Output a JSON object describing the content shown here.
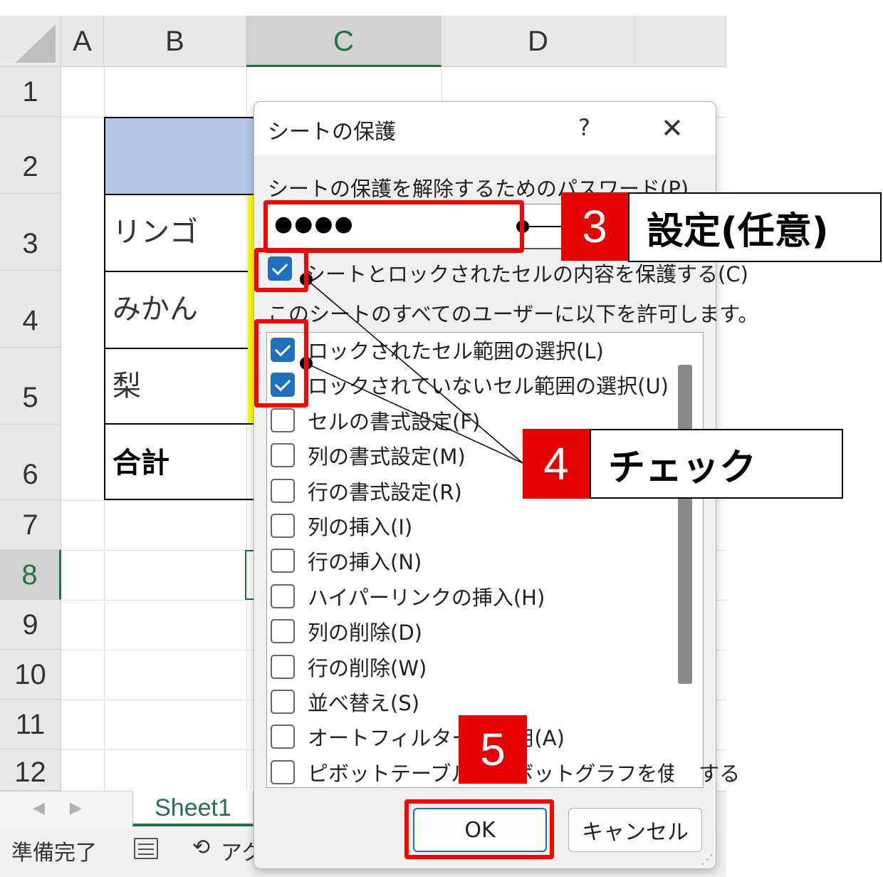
{
  "spreadsheet": {
    "columns": [
      "A",
      "B",
      "C",
      "D"
    ],
    "rows": [
      "1",
      "2",
      "3",
      "4",
      "5",
      "6",
      "7",
      "8",
      "9",
      "10",
      "11",
      "12"
    ],
    "selected_column": "C",
    "selected_row": "8",
    "cells": {
      "b3": "リンゴ",
      "b4": "みかん",
      "b5": "梨",
      "b6": "合計"
    },
    "sheet_tab": "Sheet1",
    "status": {
      "ready": "準備完了",
      "accessibility": "アク"
    },
    "colors": {
      "header_fill": "#b4c6e7",
      "accent": "#217346",
      "highlight": "#ffff00"
    }
  },
  "dialog": {
    "title": "シートの保護",
    "help": "?",
    "close": "✕",
    "password_label": "シートの保護を解除するためのパスワード(P)",
    "password_value": "●●●●",
    "protect_label": "シートとロックされたセルの内容を保護する(C)",
    "protect_checked": true,
    "allow_label": "このシートのすべてのユーザーに以下を許可します。",
    "permissions": [
      {
        "label": "ロックされたセル範囲の選択(L)",
        "checked": true
      },
      {
        "label": "ロックされていないセル範囲の選択(U)",
        "checked": true
      },
      {
        "label": "セルの書式設定(F)",
        "checked": false
      },
      {
        "label": "列の書式設定(M)",
        "checked": false
      },
      {
        "label": "行の書式設定(R)",
        "checked": false
      },
      {
        "label": "列の挿入(I)",
        "checked": false
      },
      {
        "label": "行の挿入(N)",
        "checked": false
      },
      {
        "label": "ハイパーリンクの挿入(H)",
        "checked": false
      },
      {
        "label": "列の削除(D)",
        "checked": false
      },
      {
        "label": "行の削除(W)",
        "checked": false
      },
      {
        "label": "並べ替え(S)",
        "checked": false
      },
      {
        "label": "オートフィルターの使用(A)",
        "checked": false
      },
      {
        "label": "ピボットテーブルとピボットグラフを使用する",
        "checked": false
      }
    ],
    "ok": "OK",
    "cancel": "キャンセル"
  },
  "annotations": {
    "step3": {
      "number": "3",
      "text": "設定(任意)"
    },
    "step4": {
      "number": "4",
      "text": "チェック"
    },
    "step5": {
      "number": "5"
    },
    "colors": {
      "red": "#ff0000",
      "badge": "#e60000"
    }
  }
}
